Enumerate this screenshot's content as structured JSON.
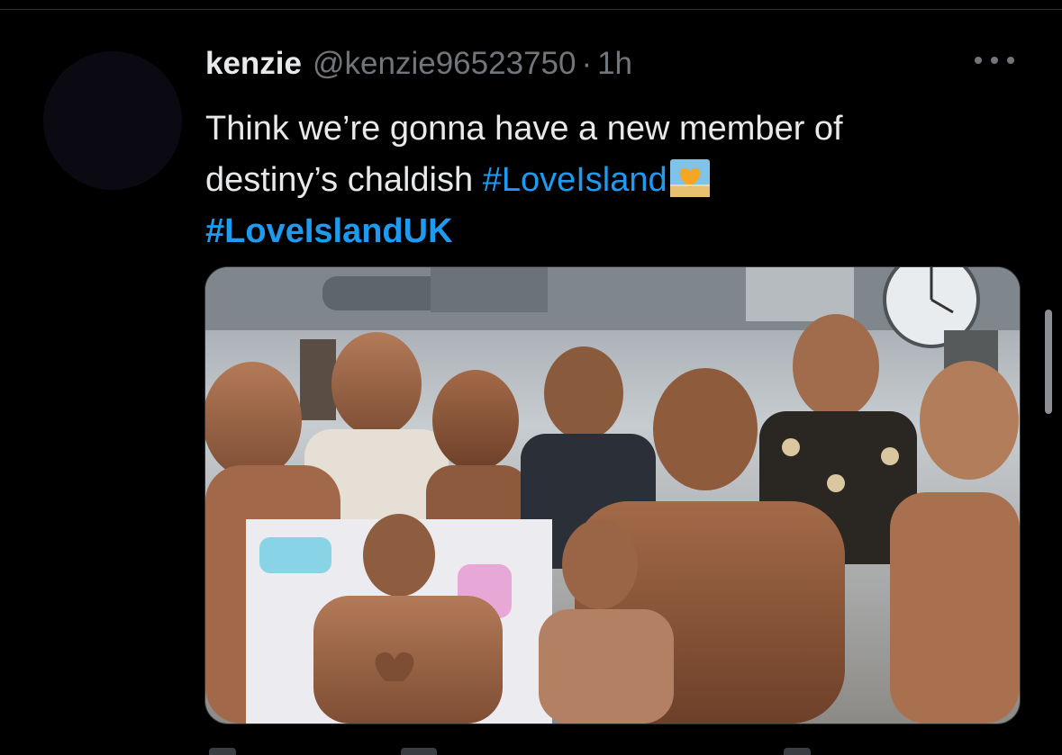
{
  "tweet": {
    "author_name": "kenzie",
    "author_handle": "@kenzie96523750",
    "separator": "·",
    "time": "1h",
    "text_line1": "Think we’re gonna have a new member of",
    "text_line2": "destiny’s chaldish ",
    "hashtag1": "#LoveIsland",
    "hashtag2": "#LoveIslandUK"
  },
  "icons": {
    "more": "more-horizontal-icon",
    "emoji": "sunrise-heart-emoji"
  },
  "colors": {
    "background": "#000000",
    "text": "#e7e9ea",
    "secondary": "#71767b",
    "link": "#1d9bf0"
  }
}
